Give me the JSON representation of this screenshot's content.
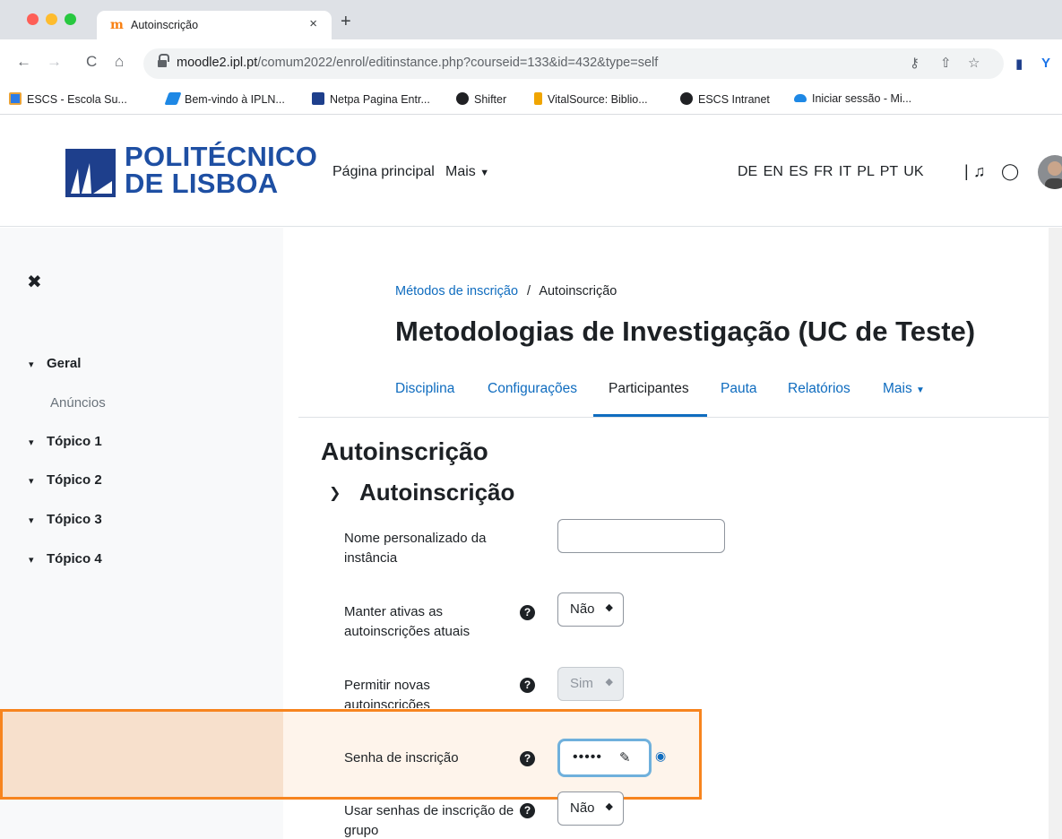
{
  "browser": {
    "tab_title": "Autoinscrição",
    "tab_close": "×",
    "new_tab": "+",
    "url_domain": "moodle2.ipl.pt",
    "url_path": "/comum2022/enrol/editinstance.php?courseid=133&id=432&type=self",
    "back": "←",
    "forward": "→",
    "reload": "C",
    "home": "⌂",
    "bookmarks": [
      {
        "label": "ESCS - Escola Su...",
        "color": "#e8a33a"
      },
      {
        "label": "Bem-vindo à IPLN...",
        "color": "#1e88e5"
      },
      {
        "label": "Netpa Pagina Entr...",
        "color": "#1e3f8c"
      },
      {
        "label": "Shifter",
        "color": "#202124"
      },
      {
        "label": "VitalSource: Biblio...",
        "color": "#f0a500"
      },
      {
        "label": "ESCS Intranet",
        "color": "#202124"
      },
      {
        "label": "Iniciar sessão - Mi...",
        "color": "#1e88e5"
      }
    ]
  },
  "header": {
    "logo_line1": "POLITÉCNICO",
    "logo_line2": "DE LISBOA",
    "nav_home": "Página principal",
    "nav_more": "Mais",
    "languages": "DE  EN  ES  FR  IT  PL  PT  UK",
    "brand_color": "#1e4fa3"
  },
  "sidebar": {
    "close": "✖",
    "items": [
      {
        "label": "Geral",
        "chev": "▾"
      },
      {
        "label": "Anúncios"
      },
      {
        "label": "Tópico 1",
        "chev": "▾"
      },
      {
        "label": "Tópico 2",
        "chev": "▾"
      },
      {
        "label": "Tópico 3",
        "chev": "▾"
      },
      {
        "label": "Tópico 4",
        "chev": "▾"
      }
    ]
  },
  "main": {
    "breadcrumb_link": "Métodos de inscrição",
    "breadcrumb_sep": "/",
    "breadcrumb_current": "Autoinscrição",
    "course_title": "Metodologias de Investigação (UC de Teste)",
    "tabs": [
      {
        "label": "Disciplina"
      },
      {
        "label": "Configurações"
      },
      {
        "label": "Participantes",
        "active": true
      },
      {
        "label": "Pauta"
      },
      {
        "label": "Relatórios"
      },
      {
        "label": "Mais"
      }
    ],
    "heading": "Autoinscrição",
    "section_heading": "Autoinscrição",
    "section_chev": "⌄",
    "accent_color": "#0f6cbf",
    "fields": {
      "custom_name": {
        "label": "Nome personalizado da instância",
        "value": ""
      },
      "keep_active": {
        "label": "Manter ativas as autoinscrições atuais",
        "value": "Não",
        "help": "?"
      },
      "allow_new": {
        "label": "Permitir novas autoinscrições",
        "value": "Sim",
        "help": "?"
      },
      "enrol_key": {
        "label": "Senha de inscrição",
        "value": "•••••",
        "help": "?"
      },
      "group_keys": {
        "label": "Usar senhas de inscrição de grupo",
        "value": "Não",
        "help": "?"
      }
    },
    "highlight_color": "#f7841e"
  }
}
